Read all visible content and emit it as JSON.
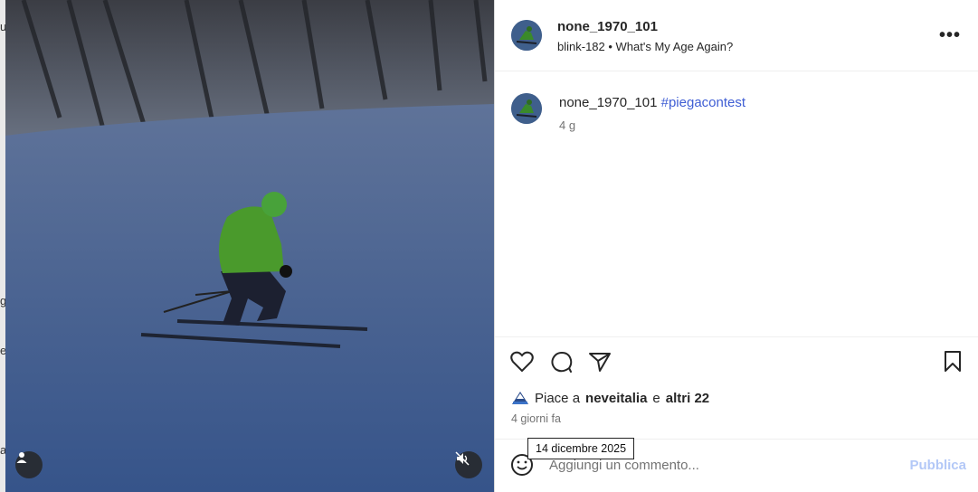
{
  "left_edge": {
    "chars": [
      "u",
      "g",
      "e",
      "a"
    ]
  },
  "media": {
    "profile_icon": "person-icon",
    "audio_icon": "muted-speaker-icon"
  },
  "post": {
    "username": "none_1970_101",
    "audio": "blink-182 • What's My Age Again?",
    "more_label": "•••"
  },
  "caption": {
    "username": "none_1970_101",
    "hashtag": "#piegacontest",
    "age": "4 g"
  },
  "likes": {
    "prefix": "Piace a",
    "user": "neveitalia",
    "connector": "e",
    "others": "altri 22"
  },
  "date": "4 giorni fa",
  "tooltip": "14 dicembre 2025",
  "comment": {
    "placeholder": "Aggiungi un commento...",
    "publish": "Pubblica"
  },
  "colors": {
    "link": "#3f5ed4",
    "publish_disabled": "#b3c8f7"
  }
}
